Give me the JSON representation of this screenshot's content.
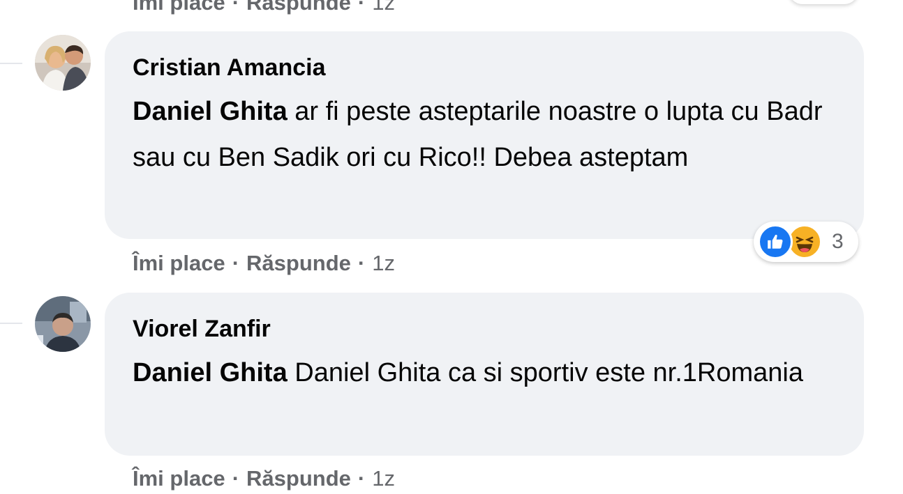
{
  "actions": {
    "like": "Îmi place",
    "reply": "Răspunde",
    "separator": "·",
    "time": "1z"
  },
  "comments": [
    {
      "author": "Cristian Amancia",
      "mention": "Daniel Ghita",
      "text": "ar fi peste asteptarile noastre o lupta cu Badr sau cu Ben Sadik ori cu Rico!! Debea asteptam",
      "reactions": {
        "icons": [
          "like-icon",
          "haha-icon"
        ],
        "count": "3"
      }
    },
    {
      "author": "Viorel Zanfir",
      "mention": "Daniel Ghita",
      "text": "Daniel Ghita ca si sportiv este nr.1Romania"
    }
  ],
  "colors": {
    "bubble": "#f0f2f5",
    "meta_text": "#65676b",
    "like_blue": "#1877f2",
    "haha_yellow": "#f7b125"
  }
}
